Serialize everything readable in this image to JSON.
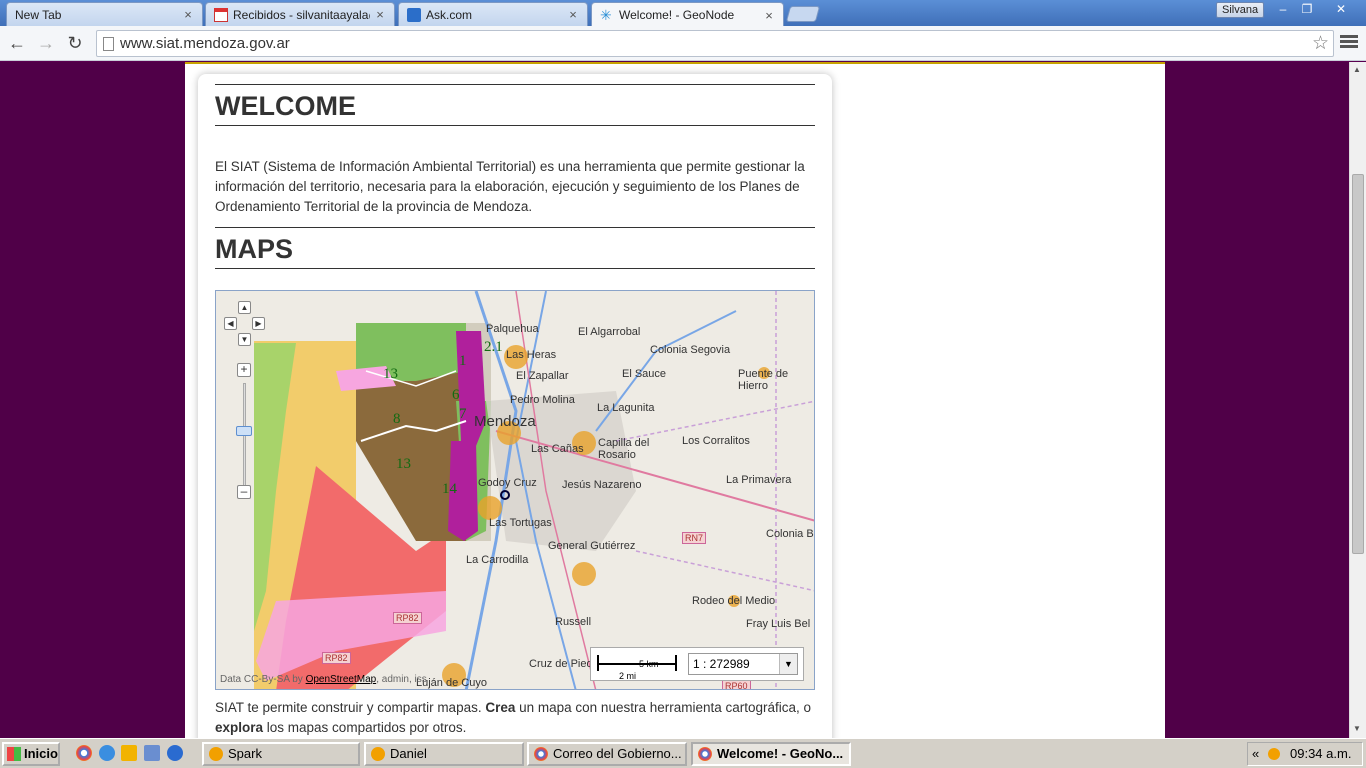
{
  "browser": {
    "tabs": [
      {
        "title": "New Tab",
        "active": false
      },
      {
        "title": "Recibidos - silvanitaayala@g",
        "active": false
      },
      {
        "title": "Ask.com",
        "active": false
      },
      {
        "title": "Welcome! - GeoNode",
        "active": true
      }
    ],
    "tab_close": "×",
    "user_name": "Silvana",
    "url": "www.siat.mendoza.gov.ar",
    "window_controls": {
      "minimize": "–",
      "restore": "❐",
      "close": "✕"
    }
  },
  "page": {
    "welcome_title": "WELCOME",
    "intro_text": "El SIAT (Sistema de Información Ambiental Territorial) es una herramienta que permite gestionar la información del territorio, necesaria para la elaboración, ejecución y seguimiento de los Planes de Ordenamiento Territorial de la provincia de Mendoza.",
    "maps_title": "MAPS",
    "after_map": {
      "prefix": "SIAT te permite construir y compartir mapas. ",
      "create": "Crea",
      "middle": " un mapa con nuestra herramienta cartográfica, o ",
      "explore": "explora",
      "suffix": " los mapas compartidos por otros."
    }
  },
  "map": {
    "place_labels": [
      "Palquehua",
      "Las Heras",
      "El Algarrobal",
      "Colonia Segovia",
      "El Zapallar",
      "El Sauce",
      "Puente de Hierro",
      "Pedro Molina",
      "La Lagunita",
      "Mendoza",
      "Capilla del Rosario",
      "Los Corralitos",
      "Las Cañas",
      "Jesús Nazareno",
      "La Primavera",
      "Godoy Cruz",
      "Las Tortugas",
      "RN7",
      "Colonia B",
      "General Gutiérrez",
      "La Carrodilla",
      "Rodeo del Medio",
      "Fray Luis Bel",
      "Russell",
      "Cruz de Pied",
      "Luján de Cuyo",
      "RP60",
      "RP82",
      "RP82"
    ],
    "zone_labels": [
      "2.1",
      "13",
      "1",
      "6",
      "8",
      "7",
      "13",
      "14"
    ],
    "scale": {
      "km": "5 km",
      "mi": "2 mi",
      "ratio": "1 : 272989"
    },
    "attribution": {
      "prefix": "Data CC-By-SA by ",
      "link": "OpenStreetMap",
      "suffix": ", admin, iss"
    },
    "controls": {
      "up": "▲",
      "left": "◀",
      "right": "▶",
      "down": "▼",
      "zoom_in": "+",
      "zoom_out": "–"
    }
  },
  "taskbar": {
    "start_label": "Inicio",
    "tasks": [
      {
        "label": "Spark",
        "active": false
      },
      {
        "label": "Daniel",
        "active": false
      },
      {
        "label": "Correo del Gobierno...",
        "active": false
      },
      {
        "label": "Welcome! - GeoNo...",
        "active": true
      }
    ],
    "tray_arrows": "«",
    "clock": "09:34 a.m."
  },
  "colors": {
    "tabstrip": "#4a7cc4",
    "page_bg": "#500048",
    "zone_green": "#7fbf5e",
    "zone_brown": "#8b6a3c",
    "zone_magenta": "#b0209c",
    "zone_red": "#f26b6b",
    "zone_yellow": "#f2cc6b",
    "marker": "#e8a32a"
  }
}
